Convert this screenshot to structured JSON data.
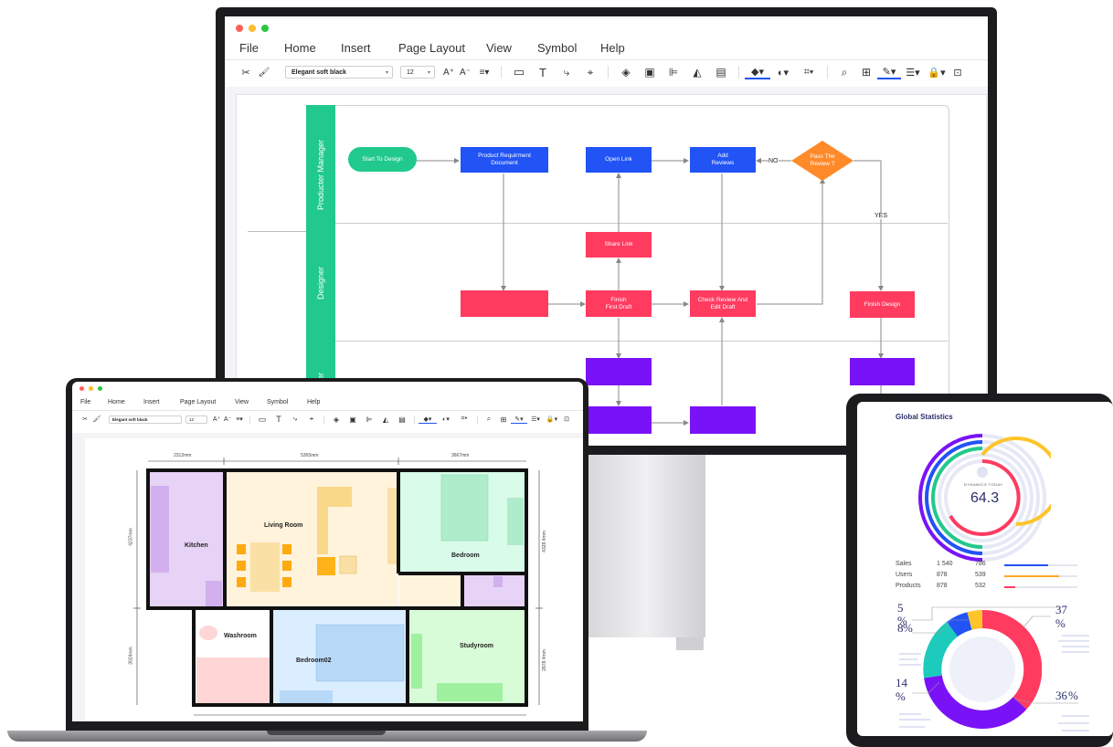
{
  "colors": {
    "lane_green": "#22c98c",
    "node_green": "#22c98c",
    "node_blue": "#2153f5",
    "node_red": "#ff3b60",
    "node_orange": "#ff8a2a",
    "node_purple": "#7a12f7",
    "accent_red": "#ff3b60",
    "accent_yellow": "#ffc42a",
    "accent_blue": "#2153f5"
  },
  "desktop": {
    "menu": [
      "File",
      "Home",
      "Insert",
      "Page Layout",
      "View",
      "Symbol",
      "Help"
    ],
    "font_name": "Elegant soft black",
    "font_size": "12",
    "lanes": [
      "Producter Manager",
      "Designer",
      "neer"
    ],
    "nodes": {
      "start": "Start To Design",
      "prd": "Product Requirment\nDocument",
      "open_link": "Open Link",
      "add_reviews": "Add\nReviews",
      "pass_review": "Pass The\nReview ?",
      "share_link": "Share Link",
      "finish_first": "Finish\nFirst Draft",
      "check_review": "Check Review And\nEdit Draft",
      "finish_design": "Finish Design"
    },
    "edge_no": "NO",
    "edge_yes": "YES"
  },
  "laptop": {
    "menu": [
      "File",
      "Home",
      "Insert",
      "Page Layout",
      "View",
      "Symbol",
      "Help"
    ],
    "font_name": "Elegant soft black",
    "font_size": "12",
    "rooms": {
      "kitchen": "Kitchen",
      "living": "Living Room",
      "bedroom": "Bedroom",
      "washroom": "Washroom",
      "bedroom02": "Bedroom02",
      "studyroom": "Studyroom"
    },
    "dims": {
      "top1": "2312mm",
      "top2": "5365mm",
      "top3": "3667mm",
      "left1": "4237mm",
      "left2": "3024mm",
      "right1": "4328.4mm",
      "right2": "2878.4mm"
    }
  },
  "tablet": {
    "title": "Global Statistics",
    "center_label": "DYNAMICS TODAY",
    "center_value": "64.3",
    "legend": [
      {
        "label": "Sales",
        "v1": "1 540",
        "v2": "786",
        "color": "#2153f5",
        "level": 0.6
      },
      {
        "label": "Users",
        "v1": "878",
        "v2": "539",
        "color": "#ffa62a",
        "level": 0.75
      },
      {
        "label": "Products",
        "v1": "878",
        "v2": "532",
        "color": "#ff3b60",
        "level": 0.15
      }
    ],
    "percents": {
      "p5": "5",
      "p5s": "%",
      "p8": "8",
      "p8s": "%",
      "p37": "37",
      "p37s": "%",
      "p14": "14",
      "p14s": "%",
      "p36": "36",
      "p36s": "%"
    }
  }
}
